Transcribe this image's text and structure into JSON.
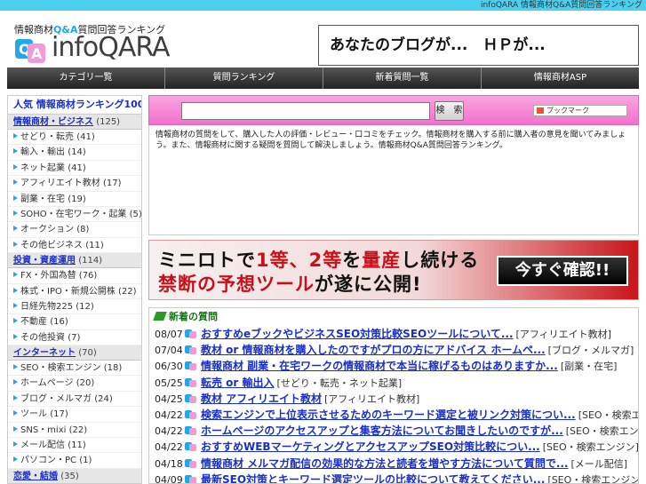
{
  "topbar": {
    "text": "infoQARA 情報商材Q&A質問回答ランキング"
  },
  "header": {
    "tagline_pre": "情報商材",
    "tagline_qa": "Q&A",
    "tagline_post": "質問回答ランキング",
    "logo_text": "infoQARA",
    "banner_text": "あなたのブログが...　ＨＰが..."
  },
  "nav": [
    "カテゴリ一覧",
    "質問ランキング",
    "新着質問一覧",
    "情報商材ASP"
  ],
  "sidebar": {
    "heading": "人気 情報商材ランキング100",
    "groups": [
      {
        "name": "情報商材・ビジネス",
        "count": "(125)",
        "items": [
          {
            "label": "せどり・転売",
            "count": "(41)"
          },
          {
            "label": "輸入・輸出",
            "count": "(14)"
          },
          {
            "label": "ネット起業",
            "count": "(41)"
          },
          {
            "label": "アフィリエイト教材",
            "count": "(17)"
          },
          {
            "label": "副業・在宅",
            "count": "(19)"
          },
          {
            "label": "SOHO・在宅ワーク・起業",
            "count": "(5)"
          },
          {
            "label": "オークション",
            "count": "(8)"
          },
          {
            "label": "その他ビジネス",
            "count": "(11)"
          }
        ]
      },
      {
        "name": "投資・資産運用",
        "count": "(114)",
        "items": [
          {
            "label": "FX・外国為替",
            "count": "(76)"
          },
          {
            "label": "株式・IPO・新規公開株",
            "count": "(22)"
          },
          {
            "label": "日経先物225",
            "count": "(12)"
          },
          {
            "label": "不動産",
            "count": "(16)"
          },
          {
            "label": "その他投資",
            "count": "(7)"
          }
        ]
      },
      {
        "name": "インターネット",
        "count": "(70)",
        "items": [
          {
            "label": "SEO・検索エンジン",
            "count": "(18)"
          },
          {
            "label": "ホームページ",
            "count": "(20)"
          },
          {
            "label": "ブログ・メルマガ",
            "count": "(24)"
          },
          {
            "label": "ツール",
            "count": "(17)"
          },
          {
            "label": "SNS・mixi",
            "count": "(22)"
          },
          {
            "label": "メール配信",
            "count": "(11)"
          },
          {
            "label": "パソコン・PC",
            "count": "(1)"
          }
        ]
      },
      {
        "name": "恋愛・結婚",
        "count": "(35)",
        "items": []
      }
    ]
  },
  "search": {
    "placeholder": "",
    "button_label": "検　索",
    "bookmark_label": "ブックマーク"
  },
  "intro": {
    "text": "情報商材の質問をして、購入した人の評価・レビュー・口コミをチェック。情報商材を購入する前に購入者の意見を聞いてみましょう。また、情報商材に関する疑問を質問して解決しましょう。情報商材Q&A質問回答ランキング。"
  },
  "ad": {
    "line1_a": "ミニロトで",
    "line1_b": "1等、2等",
    "line1_c": "を",
    "line1_d": "量産",
    "line1_e": "し続ける",
    "line2_a": "禁断の予想ツール",
    "line2_b": "が遂に公開!",
    "button": "今すぐ確認!!"
  },
  "recent": {
    "heading": "新着の質問",
    "rows": [
      {
        "date": "08/07",
        "title": "おすすめeブックやビジネスSEO対策比較SEOツールについて...",
        "category": "[アフィリエイト教材]"
      },
      {
        "date": "07/04",
        "title": "教材 or 情報商材を購入したのですがプロの方にアドバイス ホームペ...",
        "category": "[ブログ・メルマガ]"
      },
      {
        "date": "06/30",
        "title": "情報商材 副業・在宅ワークの情報商材で本当に稼げるものはありますか...",
        "category": "[副業・在宅]"
      },
      {
        "date": "05/25",
        "title": "転売 or 輸出入",
        "category": "[せどり・転売・ネット起業]"
      },
      {
        "date": "04/25",
        "title": "教材 アフィリエイト教材",
        "category": "[アフィリエイト教材]"
      },
      {
        "date": "04/22",
        "title": "検索エンジンで上位表示させるためのキーワード選定と被リンク対策につい...",
        "category": "[SEO・検索エンジン]"
      },
      {
        "date": "04/22",
        "title": "ホームページのアクセスアップと集客方法についてお聞きしたいのですが...",
        "category": "[SEO・検索エンジン]"
      },
      {
        "date": "04/22",
        "title": "おすすめWEBマーケティングとアクセスアップSEO対策比較につい...",
        "category": "[SEO・検索エンジン]"
      },
      {
        "date": "04/18",
        "title": "情報商材 メルマガ配信の効果的な方法と読者を増やす方法について質問で...",
        "category": "[メール配信]"
      },
      {
        "date": "04/09",
        "title": "最新SEO対策とキーワード選定ツールの比較について教えてください...",
        "category": "[SEO・検索エンジン]"
      }
    ]
  },
  "colors": {
    "accent": "#1a2fc7",
    "topbar": "#4dd0f0",
    "search_bg": "#f570cd",
    "nav_bg": "#333333"
  }
}
